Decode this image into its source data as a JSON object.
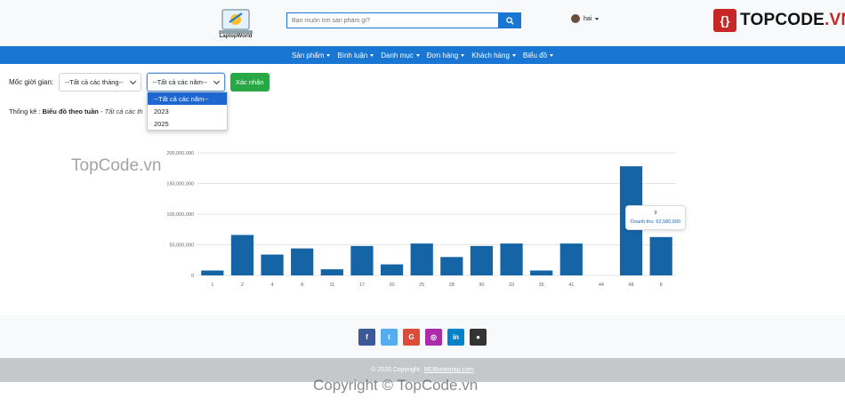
{
  "header": {
    "logo_text": "LaptopWorld",
    "search_placeholder": "Bạn muốn tìm sản phẩm gì?",
    "user_name": "hai",
    "brand_name": "TOPCODE",
    "brand_tld": ".VN"
  },
  "nav": {
    "items": [
      {
        "label": "Sản phẩm"
      },
      {
        "label": "Bình luận"
      },
      {
        "label": "Danh mục"
      },
      {
        "label": "Đơn hàng"
      },
      {
        "label": "Khách hàng"
      },
      {
        "label": "Biểu đồ"
      }
    ]
  },
  "filters": {
    "label": "Mốc giời gian:",
    "month_select": "--Tất cả các tháng--",
    "year_select": "--Tất cả các năm--",
    "confirm_label": "Xác nhận",
    "year_options": [
      "--Tất cả các năm--",
      "2023",
      "2025"
    ]
  },
  "stat": {
    "prefix": "Thống kê :",
    "type": "Biểu đồ theo tuần",
    "sep": " - ",
    "scope": "Tất cả các th"
  },
  "chart_data": {
    "type": "bar",
    "categories": [
      "1",
      "2",
      "4",
      "8",
      "11",
      "17",
      "20",
      "25",
      "28",
      "30",
      "33",
      "35",
      "41",
      "44",
      "48",
      "8"
    ],
    "values": [
      8000000,
      66000000,
      34000000,
      44000000,
      10000000,
      48000000,
      18000000,
      52000000,
      30000000,
      48000000,
      52000000,
      8000000,
      52000000,
      0,
      178000000,
      62580000
    ],
    "ylim": [
      0,
      200000000
    ],
    "ytick_labels": [
      "0",
      "50,000,000",
      "100,000,000",
      "150,000,000",
      "200,000,000"
    ],
    "color": "#1565a6",
    "grid": true,
    "tooltip_title": "9",
    "tooltip_label": "Doanh thu: 62,580,000"
  },
  "watermarks": {
    "top": "TopCode.vn",
    "bottom": "Copyright © TopCode.vn"
  },
  "footer": {
    "social": [
      {
        "icon": "facebook-icon",
        "glyph": "f",
        "color": "#3b5998"
      },
      {
        "icon": "twitter-icon",
        "glyph": "t",
        "color": "#55acee"
      },
      {
        "icon": "google-plus-icon",
        "glyph": "G",
        "color": "#dd4b39"
      },
      {
        "icon": "instagram-icon",
        "glyph": "◎",
        "color": "#ac2bac"
      },
      {
        "icon": "linkedin-icon",
        "glyph": "in",
        "color": "#0082ca"
      },
      {
        "icon": "github-icon",
        "glyph": "●",
        "color": "#333333"
      }
    ],
    "copyright_text": "© 2020 Copyright:",
    "copyright_link": "MDBootstrap.com"
  }
}
